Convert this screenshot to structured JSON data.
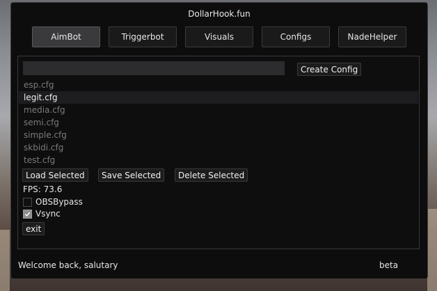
{
  "window": {
    "title": "DollarHook.fun"
  },
  "tabs": [
    {
      "label": "AimBot",
      "active": true
    },
    {
      "label": "Triggerbot",
      "active": false
    },
    {
      "label": "Visuals",
      "active": false
    },
    {
      "label": "Configs",
      "active": false
    },
    {
      "label": "NadeHelper",
      "active": false
    }
  ],
  "config": {
    "name_input_value": "",
    "create_button": "Create Config",
    "files": [
      {
        "name": "esp.cfg",
        "selected": false
      },
      {
        "name": "legit.cfg",
        "selected": true
      },
      {
        "name": "media.cfg",
        "selected": false
      },
      {
        "name": "semi.cfg",
        "selected": false
      },
      {
        "name": "simple.cfg",
        "selected": false
      },
      {
        "name": "skbidi.cfg",
        "selected": false
      },
      {
        "name": "test.cfg",
        "selected": false
      }
    ],
    "load_button": "Load Selected",
    "save_button": "Save Selected",
    "delete_button": "Delete Selected"
  },
  "fps": "FPS: 73.6",
  "options": [
    {
      "label": "OBSBypass",
      "checked": false
    },
    {
      "label": "Vsync",
      "checked": true
    }
  ],
  "exit_button": "exit",
  "status": {
    "welcome": "Welcome back, salutary",
    "version": "beta"
  },
  "icons": {
    "checkmark": "checkmark-icon"
  }
}
